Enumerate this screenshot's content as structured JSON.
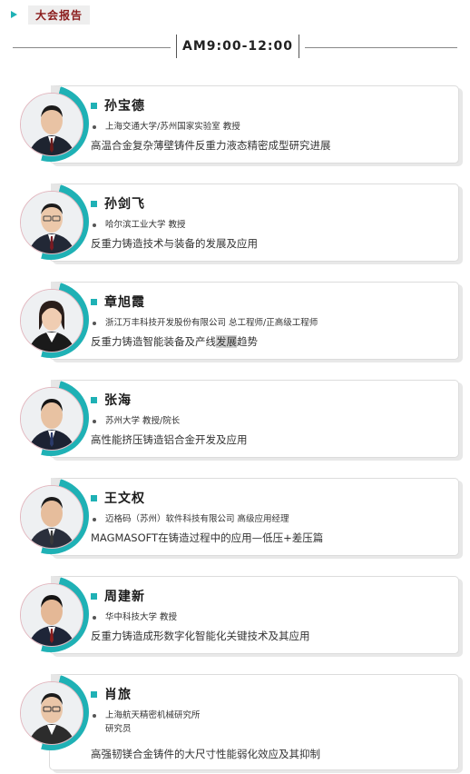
{
  "section": {
    "label": "大会报告"
  },
  "session": {
    "time": "AM9:00-12:00"
  },
  "speakers": [
    {
      "name": "孙宝德",
      "affiliation": "上海交通大学/苏州国家实验室  教授",
      "topic": "高温合金复杂薄壁铸件反重力液态精密成型研究进展"
    },
    {
      "name": "孙剑飞",
      "affiliation": "哈尔滨工业大学  教授",
      "topic": "反重力铸造技术与装备的发展及应用"
    },
    {
      "name": "章旭霞",
      "affiliation": "浙江万丰科技开发股份有限公司  总工程师/正高级工程师",
      "topic_a": "反重力铸造智能装备及产线",
      "topic_hl": "发展",
      "topic_b": "趋势"
    },
    {
      "name": "张海",
      "affiliation": "苏州大学  教授/院长",
      "topic": "高性能挤压铸造铝合金开发及应用"
    },
    {
      "name": "王文权",
      "affiliation": "迈格码（苏州）软件科技有限公司  高级应用经理",
      "topic": "MAGMASOFT在铸造过程中的应用—低压+差压篇"
    },
    {
      "name": "周建新",
      "affiliation": "华中科技大学  教授",
      "topic": "反重力铸造成形数字化智能化关键技术及其应用"
    },
    {
      "name": "肖旅",
      "affiliation_line1": "上海航天精密机械研究所",
      "affiliation_line2": "研究员",
      "topic": "高强韧镁合金铸件的大尺寸性能弱化效应及其抑制"
    }
  ],
  "colors": {
    "accent": "#1fb1b5",
    "tag_text": "#8a1b1b"
  },
  "icons": {
    "bullet": "square-bullet-icon",
    "play": "play-triangle-icon"
  }
}
